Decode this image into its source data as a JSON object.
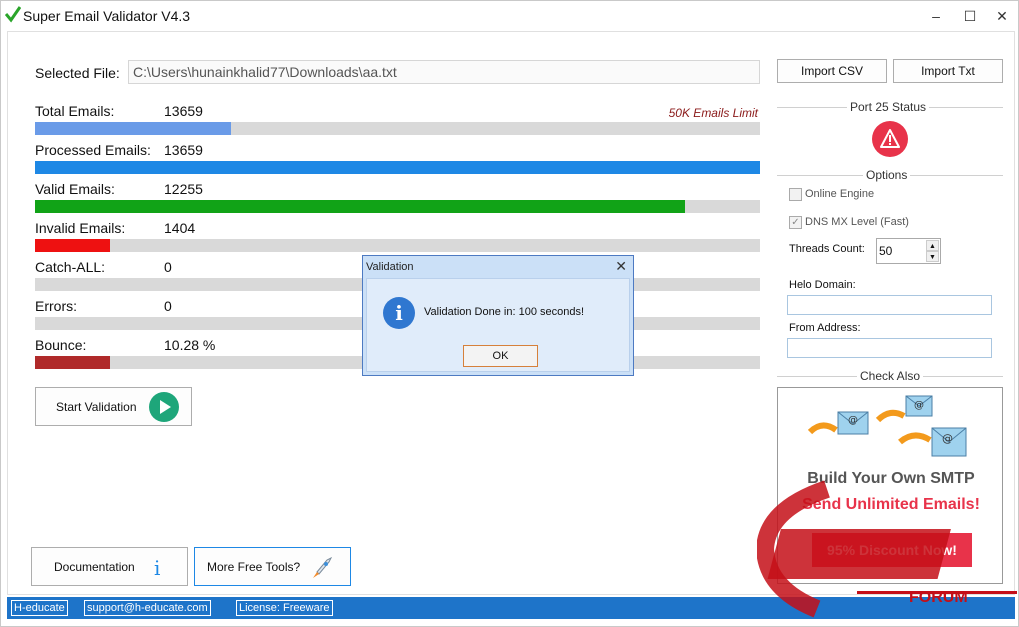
{
  "window": {
    "title": "Super Email Validator V4.3",
    "controls": [
      "–",
      "☐",
      "✕"
    ]
  },
  "file": {
    "label": "Selected File:",
    "path": "C:\\Users\\hunainkhalid77\\Downloads\\aa.txt"
  },
  "limit_note": "50K Emails Limit",
  "stats": [
    {
      "label": "Total Emails:",
      "value": "13659",
      "fraction": 0.27,
      "color": "#6a9be8"
    },
    {
      "label": "Processed Emails:",
      "value": "13659",
      "fraction": 1.0,
      "color": "#1e88e5"
    },
    {
      "label": "Valid Emails:",
      "value": "12255",
      "fraction": 0.897,
      "color": "#11a317"
    },
    {
      "label": "Invalid Emails:",
      "value": "1404",
      "fraction": 0.103,
      "color": "#ee1111"
    },
    {
      "label": "Catch-ALL:",
      "value": "0",
      "fraction": 0.0,
      "color": "#d9d9d9"
    },
    {
      "label": "Errors:",
      "value": "0",
      "fraction": 0.0,
      "color": "#d9d9d9"
    },
    {
      "label": "Bounce:",
      "value": "10.28 %",
      "fraction": 0.1028,
      "color": "#b02a2a"
    }
  ],
  "buttons": {
    "start": "Start Validation",
    "documentation": "Documentation",
    "more_tools": "More Free Tools?",
    "import_csv": "Import CSV",
    "import_txt": "Import Txt"
  },
  "sidebar": {
    "port_status_label": "Port  25 Status",
    "options_title": "Options",
    "online_engine": "Online Engine",
    "dns_mx": "DNS MX Level (Fast)",
    "threads_label": "Threads Count:",
    "threads_value": "50",
    "helo_label": "Helo Domain:",
    "from_label": "From Address:",
    "check_also": "Check Also"
  },
  "ad": {
    "headline": "Build Your Own SMTP",
    "subheadline": "Send Unlimited Emails!",
    "cta": "95% Discount Now!"
  },
  "dialog": {
    "title": "Validation",
    "message": "Validation Done in: 100 seconds!",
    "ok": "OK"
  },
  "statusbar": {
    "company": "H-educate",
    "email": "support@h-educate.com",
    "license": "License: Freeware"
  },
  "watermark": {
    "text": "FORUM"
  }
}
